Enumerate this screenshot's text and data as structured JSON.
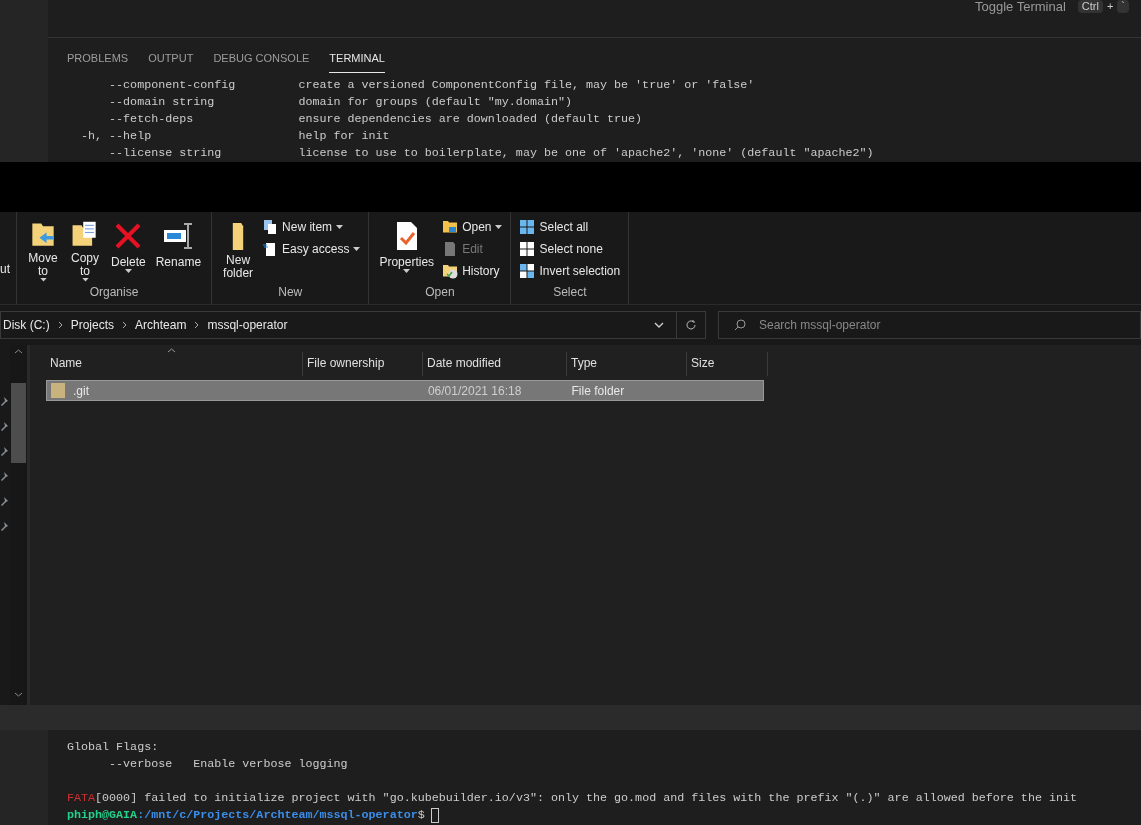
{
  "vscode": {
    "toggle_terminal": {
      "label": "Toggle Terminal",
      "keys": [
        "Ctrl",
        "`"
      ],
      "separator": "+"
    },
    "panel_tabs": [
      {
        "label": "PROBLEMS",
        "selected": false
      },
      {
        "label": "OUTPUT",
        "selected": false
      },
      {
        "label": "DEBUG CONSOLE",
        "selected": false
      },
      {
        "label": "TERMINAL",
        "selected": true
      }
    ],
    "terminal_lines": [
      "      --component-config         create a versioned ComponentConfig file, may be 'true' or 'false'",
      "      --domain string            domain for groups (default \"my.domain\")",
      "      --fetch-deps               ensure dependencies are downloaded (default true)",
      "  -h, --help                     help for init",
      "      --license string           license to use to boilerplate, may be one of 'apache2', 'none' (default \"apache2\")"
    ]
  },
  "explorer": {
    "ribbon_cut_label": "ut",
    "groups": [
      {
        "name": "Organise",
        "items": [
          {
            "kind": "large",
            "label": "Move to",
            "dropdown": true,
            "disabled": false
          },
          {
            "kind": "large",
            "label": "Copy to",
            "dropdown": true,
            "disabled": false
          },
          {
            "kind": "large",
            "label": "Delete",
            "dropdown": true,
            "disabled": false
          },
          {
            "kind": "large",
            "label": "Rename",
            "dropdown": false,
            "disabled": false
          }
        ]
      },
      {
        "name": "New",
        "items": [
          {
            "kind": "large",
            "label": "New folder",
            "dropdown": false,
            "disabled": false
          },
          {
            "kind": "small",
            "label": "New item",
            "dropdown": true,
            "disabled": false
          },
          {
            "kind": "small",
            "label": "Easy access",
            "dropdown": true,
            "disabled": false
          }
        ]
      },
      {
        "name": "Open",
        "items": [
          {
            "kind": "large",
            "label": "Properties",
            "dropdown": true,
            "disabled": false
          },
          {
            "kind": "small",
            "label": "Open",
            "dropdown": true,
            "disabled": false
          },
          {
            "kind": "small",
            "label": "Edit",
            "dropdown": false,
            "disabled": true
          },
          {
            "kind": "small",
            "label": "History",
            "dropdown": false,
            "disabled": false
          }
        ]
      },
      {
        "name": "Select",
        "items": [
          {
            "kind": "small",
            "label": "Select all",
            "dropdown": false,
            "disabled": false
          },
          {
            "kind": "small",
            "label": "Select none",
            "dropdown": false,
            "disabled": false
          },
          {
            "kind": "small",
            "label": "Invert selection",
            "dropdown": false,
            "disabled": false
          }
        ]
      }
    ],
    "breadcrumb": [
      "Disk (C:)",
      "Projects",
      "Archteam",
      "mssql-operator"
    ],
    "search": {
      "placeholder": "Search mssql-operator"
    },
    "columns": [
      "Name",
      "File ownership",
      "Date modified",
      "Type",
      "Size"
    ],
    "rows": [
      {
        "name": ".git",
        "date": "06/01/2021 16:18",
        "type": "File folder",
        "selected": true
      }
    ]
  },
  "terminal": {
    "lines": [
      "Global Flags:",
      "      --verbose   Enable verbose logging"
    ],
    "error": {
      "level": "FATA",
      "text": "[0000] failed to initialize project with \"go.kubebuilder.io/v3\": only the go.mod and files with the prefix \"(.)\" are allowed before the init"
    },
    "prompt": {
      "user": "phiph@GAIA",
      "path": ":/mnt/c/Projects/Archteam/mssql-operator",
      "symbol": "$"
    }
  }
}
